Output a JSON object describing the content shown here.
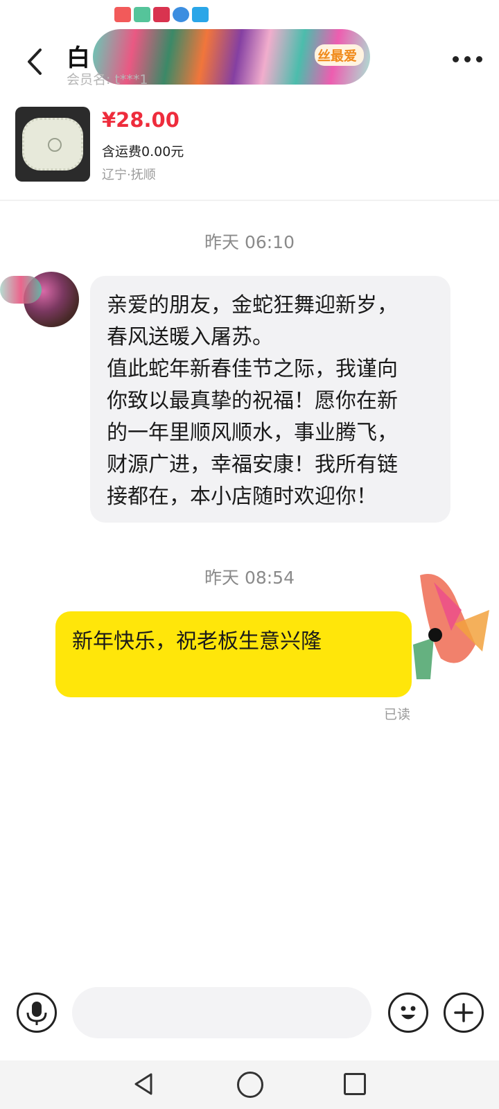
{
  "header": {
    "title": "白",
    "badge": "丝最爱",
    "member_label": "会员名: t***1"
  },
  "product": {
    "price": "¥28.00",
    "shipping": "含运费0.00元",
    "location": "辽宁·抚顺"
  },
  "messages": [
    {
      "timestamp": "昨天 06:10",
      "lines": [
        "亲爱的朋友，金蛇狂舞迎新岁，",
        "春风送暖入屠苏。",
        "值此蛇年新春佳节之际，我谨向",
        "你致以最真挚的祝福！愿你在新",
        "的一年里顺风顺水，事业腾飞，",
        "财源广进，幸福安康！我所有链",
        "接都在，本小店随时欢迎你！"
      ]
    },
    {
      "timestamp": "昨天 08:54",
      "text": "新年快乐，祝老板生意兴隆",
      "status": "已读"
    }
  ],
  "input": {
    "placeholder": ""
  },
  "colors": {
    "price": "#ee2c3c",
    "outgoing_bubble": "#ffe60a",
    "incoming_bubble": "#f2f2f4",
    "badge": "#f08a1a"
  },
  "icons": {
    "back": "chevron-left-icon",
    "more": "more-dots-icon",
    "voice": "microphone-icon",
    "emoji": "emoji-icon",
    "plus": "plus-icon",
    "nav_back": "triangle-back-icon",
    "nav_home": "circle-home-icon",
    "nav_recent": "square-recent-icon"
  }
}
